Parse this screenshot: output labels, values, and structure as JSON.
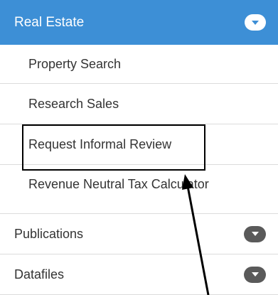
{
  "menu": {
    "header": {
      "label": "Real Estate",
      "toggle_icon": "chevron-down-icon",
      "color": "#3d8fd6"
    },
    "subitems": [
      {
        "label": "Property Search"
      },
      {
        "label": "Research Sales"
      },
      {
        "label": "Request Informal Review"
      },
      {
        "label": "Revenue Neutral Tax Calculator"
      }
    ],
    "items": [
      {
        "label": "Publications",
        "toggle_icon": "chevron-down-icon"
      },
      {
        "label": "Datafiles",
        "toggle_icon": "chevron-down-icon"
      }
    ]
  },
  "annotation": {
    "highlighted_item": "Request Informal Review",
    "highlight_color": "#000000"
  }
}
